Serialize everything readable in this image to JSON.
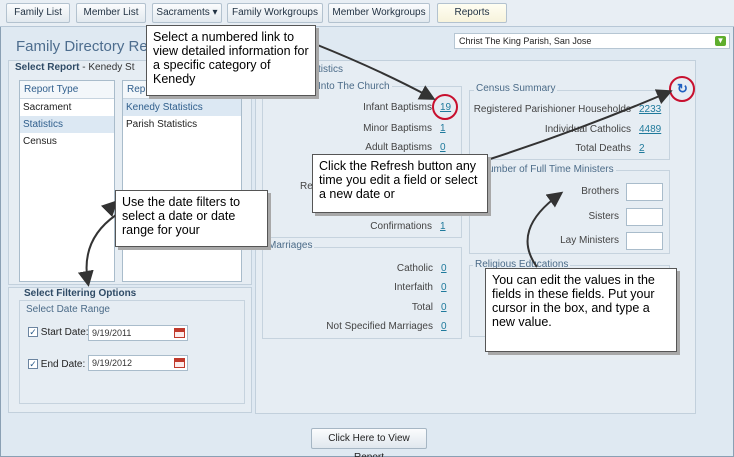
{
  "nav": {
    "tabs": [
      "Family List",
      "Member List",
      "Sacraments ▾",
      "Family Workgroups",
      "Member Workgroups",
      "Reports"
    ]
  },
  "header": {
    "title": "Family Directory Re",
    "parish": "Christ The King Parish, San Jose"
  },
  "select_report": {
    "label": "Select Report",
    "sub": "- Kenedy St",
    "type_header": "Report Type",
    "types": [
      "Sacrament",
      "Statistics",
      "Census"
    ],
    "report_header": "Rep",
    "reports": [
      "Kenedy Statistics",
      "Parish Statistics"
    ]
  },
  "filtering": {
    "label": "Select Filtering Options",
    "range_title": "Select Date Range",
    "start_label": "Start Date:",
    "start_value": "9/19/2011",
    "end_label": "End Date:",
    "end_value": "9/19/2012"
  },
  "stats": {
    "heading_fragment": "tistics",
    "into_church_title": "Into The Church",
    "infant_label": "Infant Baptisms",
    "infant_value": "19",
    "minor_label": "Minor Baptisms",
    "minor_value": "1",
    "adult_label": "Adult Baptisms",
    "adult_value": "0",
    "re_fragment": "Re",
    "confirm_label": "Confirmations",
    "confirm_value": "1",
    "marriages_title": "Marriages",
    "catholic_label": "Catholic",
    "catholic_value": "0",
    "interfaith_label": "Interfaith",
    "interfaith_value": "0",
    "total_label": "Total",
    "total_value": "0",
    "notspec_label": "Not Specified Marriages",
    "notspec_value": "0"
  },
  "census": {
    "title": "Census Summary",
    "households_label": "Registered Parishioner Households",
    "households_value": "2233",
    "catholics_label": "Individual Catholics",
    "catholics_value": "4489",
    "deaths_label": "Total Deaths",
    "deaths_value": "2"
  },
  "ministers": {
    "title_fragment": "umber of Full Time Ministers",
    "brothers": "Brothers",
    "sisters": "Sisters",
    "lay": "Lay Ministers"
  },
  "religious_ed": {
    "title": "Religious Educations"
  },
  "view_button": "Click Here to View Report",
  "callouts": {
    "link": "Select a numbered link to view detailed information for a specific category of Kenedy",
    "date": "Use the date filters to select a date or date range for your",
    "refresh": "Click the Refresh button any time you edit a field or select a new date or",
    "edit": "You can edit the values in the fields in these fields. Put your cursor in the box, and type a new value."
  },
  "icons": {
    "refresh": "refresh-icon",
    "calendar": "calendar-icon",
    "dropdown": "chevron-down-icon",
    "check": "checkbox-icon"
  },
  "colors": {
    "accent_link": "#1f7a9c",
    "highlight_circle": "#c8102e",
    "dropdown_green": "#5fae2e"
  }
}
